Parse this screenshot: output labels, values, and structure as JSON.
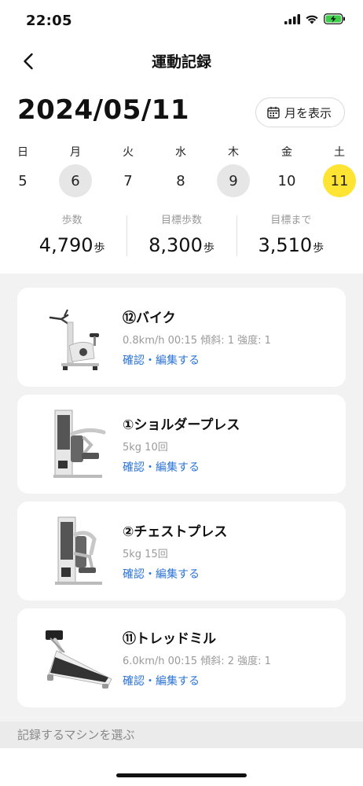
{
  "status_bar": {
    "time": "22:05"
  },
  "nav": {
    "title": "運動記録"
  },
  "date_heading": "2024/05/11",
  "month_button": {
    "label": "月を表示",
    "icon": "calendar-icon"
  },
  "week": [
    {
      "dow": "日",
      "day": "5",
      "state": "normal"
    },
    {
      "dow": "月",
      "day": "6",
      "state": "has-record"
    },
    {
      "dow": "火",
      "day": "7",
      "state": "normal"
    },
    {
      "dow": "水",
      "day": "8",
      "state": "normal"
    },
    {
      "dow": "木",
      "day": "9",
      "state": "has-record"
    },
    {
      "dow": "金",
      "day": "10",
      "state": "normal"
    },
    {
      "dow": "土",
      "day": "11",
      "state": "selected"
    }
  ],
  "stats": [
    {
      "label": "歩数",
      "value": "4,790",
      "unit": "歩"
    },
    {
      "label": "目標歩数",
      "value": "8,300",
      "unit": "歩"
    },
    {
      "label": "目標まで",
      "value": "3,510",
      "unit": "歩"
    }
  ],
  "records": [
    {
      "title": "⑫バイク",
      "detail": "0.8km/h 00:15 傾斜: 1 強度: 1",
      "link": "確認・編集する",
      "machine": "bike"
    },
    {
      "title": "①ショルダープレス",
      "detail": "5kg 10回",
      "link": "確認・編集する",
      "machine": "shoulder-press"
    },
    {
      "title": "②チェストプレス",
      "detail": "5kg 15回",
      "link": "確認・編集する",
      "machine": "chest-press"
    },
    {
      "title": "⑪トレッドミル",
      "detail": "6.0km/h 00:15 傾斜: 2 強度: 1",
      "link": "確認・編集する",
      "machine": "treadmill"
    }
  ],
  "select_machine": "記録するマシンを選ぶ",
  "colors": {
    "selected_day": "#ffe433",
    "link": "#2c74d6",
    "list_background": "#f2f2f2"
  }
}
